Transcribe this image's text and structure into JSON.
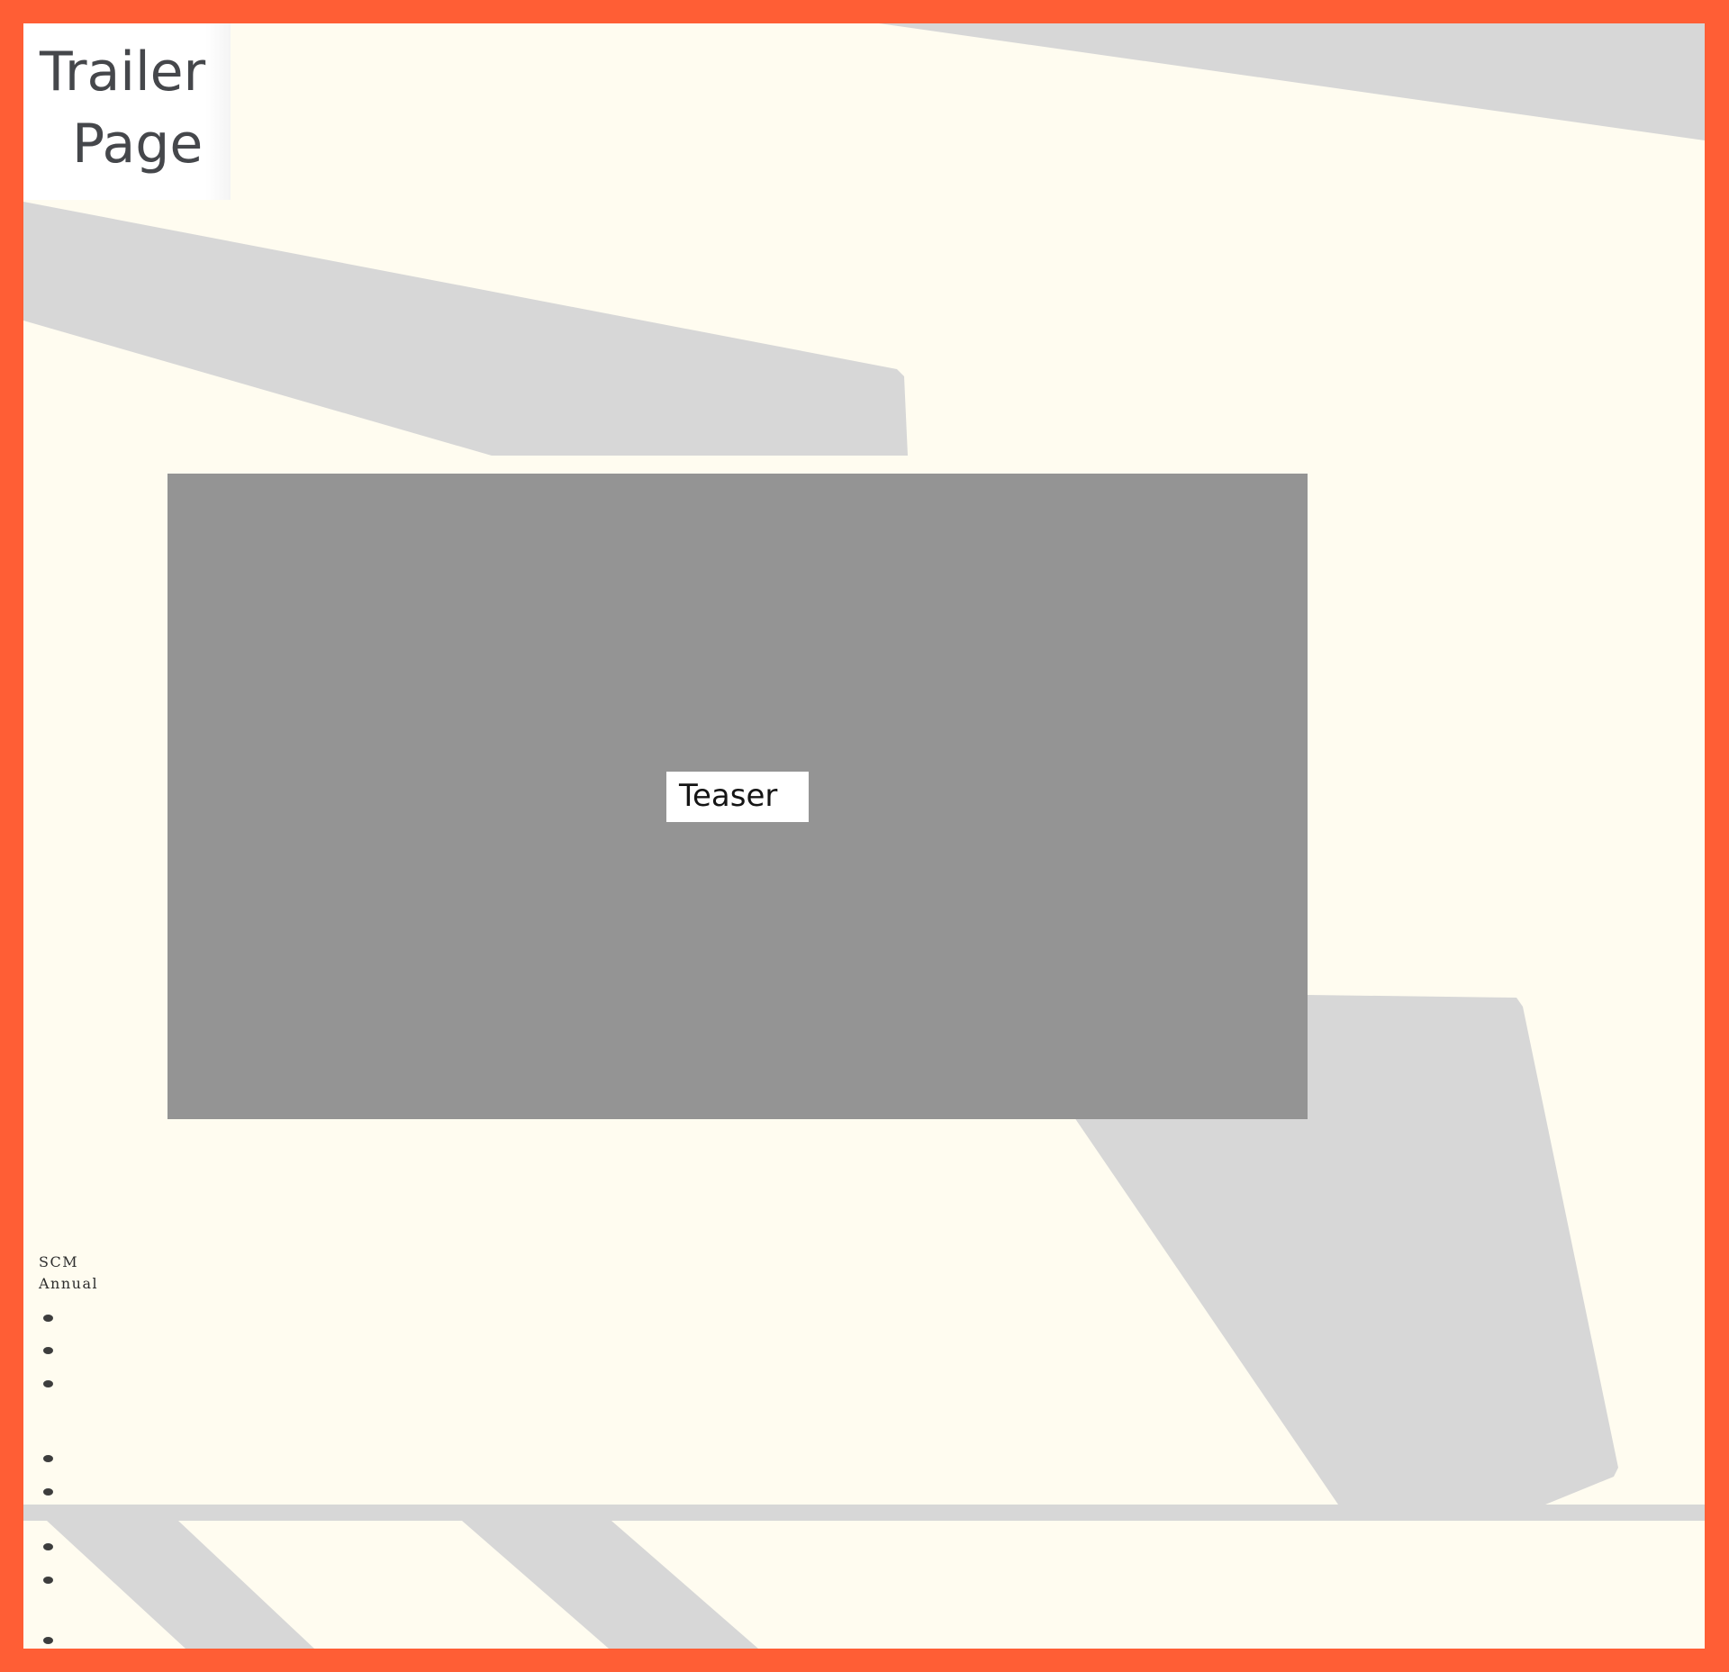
{
  "title": {
    "line1": "Trailer",
    "line2": "Page"
  },
  "video": {
    "button_label": "Teaser"
  },
  "brand": {
    "line1": "SCM",
    "line2": "Annual"
  },
  "colors": {
    "frame": "#ff5e35",
    "canvas": "#fffcf0",
    "shape": "#d7d7d7",
    "video": "#949494",
    "text_dark": "#45474b"
  }
}
